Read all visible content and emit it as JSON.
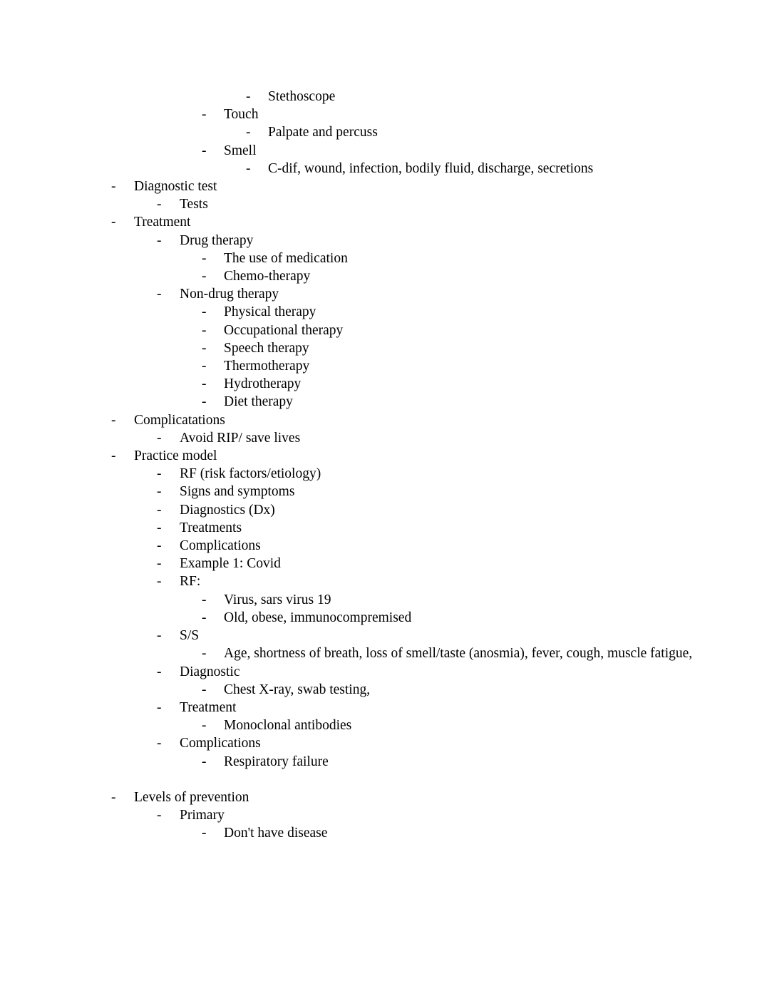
{
  "document": {
    "page_background": "#ffffff",
    "text_color": "#000000",
    "outline": [
      {
        "level": 4,
        "bullet": "-",
        "text": "Stethoscope"
      },
      {
        "level": 3,
        "bullet": "-",
        "text": "Touch"
      },
      {
        "level": 4,
        "bullet": "-",
        "text": "Palpate and percuss"
      },
      {
        "level": 3,
        "bullet": "-",
        "text": "Smell"
      },
      {
        "level": 4,
        "bullet": "-",
        "text": "C-dif, wound, infection, bodily fluid, discharge, secretions"
      },
      {
        "level": 1,
        "bullet": "-",
        "text": "Diagnostic test"
      },
      {
        "level": 2,
        "bullet": "-",
        "text": "Tests"
      },
      {
        "level": 1,
        "bullet": "-",
        "text": "Treatment"
      },
      {
        "level": 2,
        "bullet": "-",
        "text": "Drug therapy"
      },
      {
        "level": 3,
        "bullet": "-",
        "text": "The use of medication"
      },
      {
        "level": 3,
        "bullet": "-",
        "text": "Chemo-therapy"
      },
      {
        "level": 2,
        "bullet": "-",
        "text": "Non-drug therapy"
      },
      {
        "level": 3,
        "bullet": "-",
        "text": "Physical therapy"
      },
      {
        "level": 3,
        "bullet": "-",
        "text": "Occupational therapy"
      },
      {
        "level": 3,
        "bullet": "-",
        "text": "Speech therapy"
      },
      {
        "level": 3,
        "bullet": "-",
        "text": "Thermotherapy"
      },
      {
        "level": 3,
        "bullet": "-",
        "text": "Hydrotherapy"
      },
      {
        "level": 3,
        "bullet": "-",
        "text": "Diet therapy"
      },
      {
        "level": 1,
        "bullet": "-",
        "text": "Complicatations"
      },
      {
        "level": 2,
        "bullet": "-",
        "text": "Avoid RIP/ save lives"
      },
      {
        "level": 1,
        "bullet": "-",
        "text": "Practice model"
      },
      {
        "level": 2,
        "bullet": "-",
        "text": "RF (risk factors/etiology)"
      },
      {
        "level": 2,
        "bullet": "-",
        "text": "Signs and symptoms"
      },
      {
        "level": 2,
        "bullet": "-",
        "text": "Diagnostics (Dx)"
      },
      {
        "level": 2,
        "bullet": "-",
        "text": "Treatments"
      },
      {
        "level": 2,
        "bullet": "-",
        "text": "Complications"
      },
      {
        "level": 2,
        "bullet": "-",
        "text": "Example 1: Covid"
      },
      {
        "level": 2,
        "bullet": "-",
        "text": "RF:"
      },
      {
        "level": 3,
        "bullet": "-",
        "text": "Virus, sars virus 19"
      },
      {
        "level": 3,
        "bullet": "-",
        "text": "Old, obese, immunocompremised"
      },
      {
        "level": 2,
        "bullet": "-",
        "text": "S/S"
      },
      {
        "level": 3,
        "bullet": "-",
        "text": "Age, shortness of breath, loss of smell/taste (anosmia), fever, cough, muscle fatigue,"
      },
      {
        "level": 2,
        "bullet": "-",
        "text": "Diagnostic"
      },
      {
        "level": 3,
        "bullet": "-",
        "text": "Chest X-ray, swab testing,"
      },
      {
        "level": 2,
        "bullet": "-",
        "text": "Treatment"
      },
      {
        "level": 3,
        "bullet": "-",
        "text": "Monoclonal antibodies"
      },
      {
        "level": 2,
        "bullet": "-",
        "text": "Complications"
      },
      {
        "level": 3,
        "bullet": "-",
        "text": "Respiratory failure"
      },
      {
        "level": 0,
        "bullet": "",
        "text": ""
      },
      {
        "level": 1,
        "bullet": "-",
        "text": "Levels of prevention"
      },
      {
        "level": 2,
        "bullet": "-",
        "text": "Primary"
      },
      {
        "level": 3,
        "bullet": "-",
        "text": "Don't have disease"
      }
    ]
  }
}
